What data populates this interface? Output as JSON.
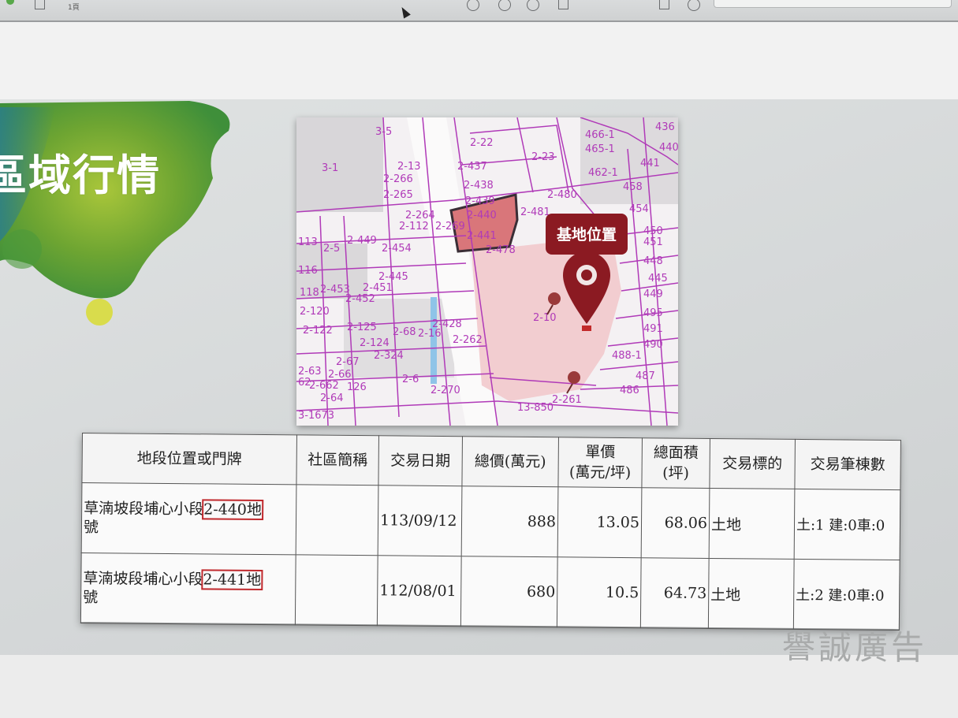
{
  "toolbar": {
    "page_indicator": "1頁"
  },
  "slide": {
    "title": "區域行情",
    "watermark": "譽誠廣告"
  },
  "map": {
    "marker_label": "基地位置",
    "parcels": [
      "3-5",
      "2-22",
      "2-23",
      "3-1",
      "2-13",
      "2-437",
      "2-266",
      "2-265",
      "2-438",
      "2-439",
      "2-480",
      "2-264",
      "2-440",
      "2-481",
      "2-112",
      "2-269",
      "2-441",
      "2-449",
      "2-454",
      "2-478",
      "2-5",
      "113",
      "116",
      "2-445",
      "2-453",
      "2-451",
      "2-452",
      "118",
      "2-120",
      "2-122",
      "2-125",
      "2-428",
      "2-10",
      "2-68",
      "2-16",
      "2-262",
      "2-124",
      "2-324",
      "2-67",
      "2-63",
      "2-66",
      "2-62",
      "2-662",
      "2-126",
      "2-64",
      "2-6",
      "2-270",
      "2-261",
      "13-850",
      "3-1673",
      "436",
      "466-1",
      "440",
      "465-1",
      "441",
      "462-1",
      "458",
      "454",
      "450",
      "451",
      "448",
      "445",
      "449",
      "495",
      "491",
      "490",
      "488-1",
      "487",
      "486"
    ]
  },
  "table": {
    "headers": [
      "地段位置或門牌",
      "社區簡稱",
      "交易日期",
      "總價(萬元)",
      "單價\n(萬元/坪)",
      "總面積\n(坪)",
      "交易標的",
      "交易筆棟數"
    ],
    "rows": [
      {
        "loc_prefix": "草湳坡段埔心小段",
        "loc_hl": "2-440地",
        "loc_suffix": "號",
        "community": "",
        "date": "113/09/12",
        "total": "888",
        "unit": "13.05",
        "area": "68.06",
        "target": "土地",
        "count": "土:1 建:0車:0"
      },
      {
        "loc_prefix": "草湳坡段埔心小段",
        "loc_hl": "2-441地",
        "loc_suffix": "號",
        "community": "",
        "date": "112/08/01",
        "total": "680",
        "unit": "10.5",
        "area": "64.73",
        "target": "土地",
        "count": "土:2 建:0車:0"
      }
    ]
  },
  "colors": {
    "parcel_line": "#b03ab8",
    "marker": "#8b1a22",
    "highlight": "#c0282c",
    "site_fill": "#f2c9cc"
  }
}
